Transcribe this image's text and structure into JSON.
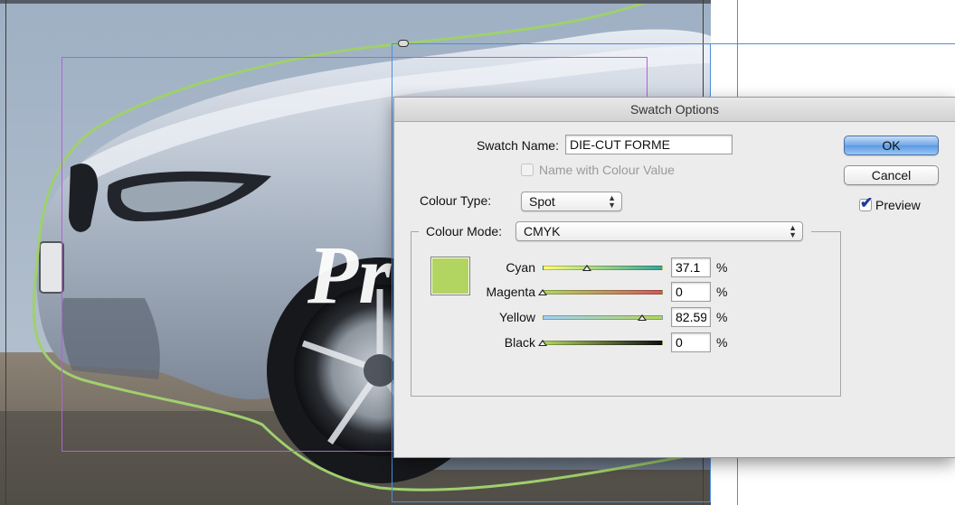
{
  "dialog": {
    "title": "Swatch Options",
    "swatch_name_label": "Swatch Name:",
    "swatch_name_value": "DIE-CUT FORME",
    "name_with_colour_value_label": "Name with Colour Value",
    "name_with_colour_value_checked": false,
    "colour_type_label": "Colour Type:",
    "colour_type_value": "Spot",
    "colour_mode_label": "Colour Mode:",
    "colour_mode_value": "CMYK",
    "ok_label": "OK",
    "cancel_label": "Cancel",
    "preview_label": "Preview",
    "preview_checked": true,
    "preview_color": "#b2d461",
    "channels": [
      {
        "name": "Cyan",
        "value": "37.1",
        "unit": "%",
        "fraction": 0.371
      },
      {
        "name": "Magenta",
        "value": "0",
        "unit": "%",
        "fraction": 0
      },
      {
        "name": "Yellow",
        "value": "82.59",
        "unit": "%",
        "fraction": 0.8259
      },
      {
        "name": "Black",
        "value": "0",
        "unit": "%",
        "fraction": 0
      }
    ]
  },
  "background": {
    "description_icon": "car-photo-with-die-cut-path"
  }
}
